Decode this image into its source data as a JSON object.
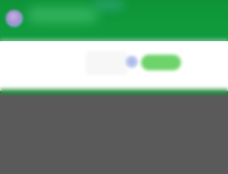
{
  "header": {
    "logo_icon": "app-logo-icon",
    "color": "#0f9a3c"
  },
  "search": {
    "placeholder": "",
    "value": "",
    "icon": "search-icon"
  },
  "actions": {
    "go_label": ""
  },
  "content": {
    "background": "#5a5a5a"
  }
}
